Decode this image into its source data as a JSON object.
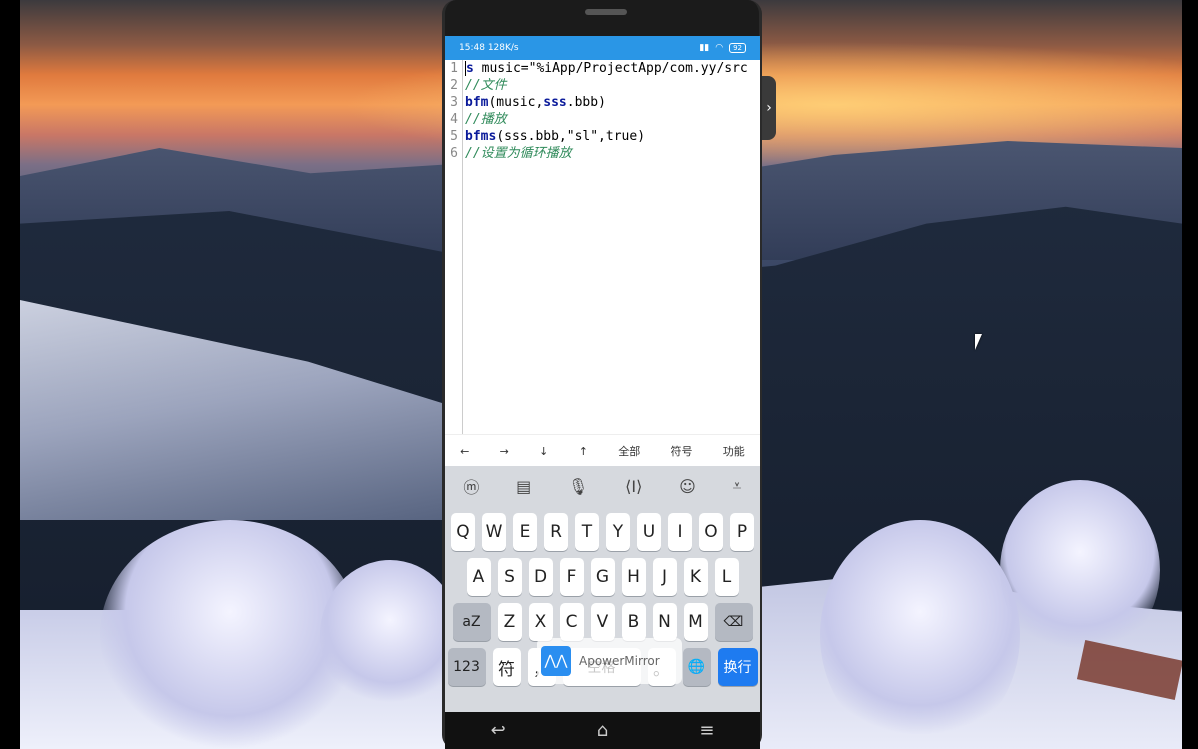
{
  "status": {
    "time": "15:48",
    "speed": "128K/s",
    "battery": "92"
  },
  "editor": {
    "line_numbers": [
      "1",
      "2",
      "3",
      "4",
      "5",
      "6"
    ],
    "lines": [
      {
        "parts": [
          {
            "t": "s",
            "c": "kw"
          },
          {
            "t": " music=\"%iApp/ProjectApp/com.yy/src",
            "c": ""
          }
        ]
      },
      {
        "parts": [
          {
            "t": "//文件",
            "c": "cm"
          }
        ]
      },
      {
        "parts": [
          {
            "t": "bfm",
            "c": "kw"
          },
          {
            "t": "(music,",
            "c": ""
          },
          {
            "t": "sss",
            "c": "kw"
          },
          {
            "t": ".bbb)",
            "c": ""
          }
        ]
      },
      {
        "parts": [
          {
            "t": "//播放",
            "c": "cm"
          }
        ]
      },
      {
        "parts": [
          {
            "t": "bfms",
            "c": "kw"
          },
          {
            "t": "(sss.bbb,\"sl\",true)",
            "c": ""
          }
        ]
      },
      {
        "parts": [
          {
            "t": "//设置为循环播放",
            "c": "cm"
          }
        ]
      }
    ]
  },
  "toolbar": {
    "left_arrow": "←",
    "right_arrow": "→",
    "down_arrow": "↓",
    "up_arrow": "↑",
    "all": "全部",
    "symbols": "符号",
    "functions": "功能"
  },
  "keyboard": {
    "top_icons": [
      "ime-icon",
      "keyboard-icon",
      "mic-icon",
      "cursor-icon",
      "emoji-icon",
      "hide-keyboard-icon"
    ],
    "row1": [
      "Q",
      "W",
      "E",
      "R",
      "T",
      "Y",
      "U",
      "I",
      "O",
      "P"
    ],
    "row2": [
      "A",
      "S",
      "D",
      "F",
      "G",
      "H",
      "J",
      "K",
      "L"
    ],
    "row3": [
      "Z",
      "X",
      "C",
      "V",
      "B",
      "N",
      "M"
    ],
    "shift_label": "aZ",
    "num_label": "123",
    "sym_label": "符",
    "comma_label": "，",
    "space_label": "空格",
    "period_label": "。",
    "enter_label": "换行"
  },
  "watermark": {
    "text": "ApowerMirror"
  }
}
